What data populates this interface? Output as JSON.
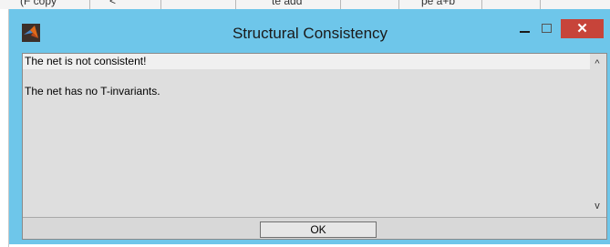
{
  "window": {
    "title": "Structural Consistency",
    "close_glyph": "✕"
  },
  "background_window": {
    "fragments": [
      "(F copy",
      "<",
      "te add",
      "pe a+b"
    ]
  },
  "messages": [
    "The net is not consistent!",
    "The net has no T-invariants."
  ],
  "scrollbar": {
    "up_glyph": "^",
    "down_glyph": "v"
  },
  "buttons": {
    "ok_label": "OK"
  },
  "colors": {
    "title_bar": "#6ec6ea",
    "close_button": "#c7443a",
    "client_bg": "#d8d8d8"
  },
  "icons": {
    "app": "matlab-icon"
  }
}
